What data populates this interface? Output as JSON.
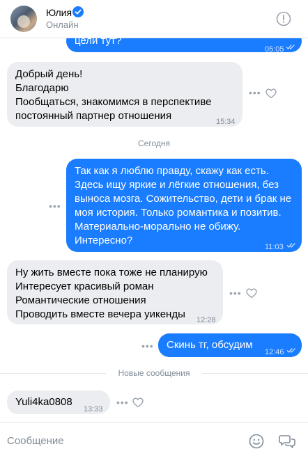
{
  "header": {
    "name": "Юлия",
    "status": "Онлайн"
  },
  "messages": {
    "m0": {
      "text": "цели тут?",
      "time": "05:05"
    },
    "m1": {
      "lines": [
        "Добрый день!",
        "Благодарю",
        "Пообщаться, знакомимся в перспективе",
        "постоянный партнер отношения"
      ],
      "time": "15:34"
    },
    "date_separator": "Сегодня",
    "m2": {
      "lines": [
        "Так как я люблю правду, скажу как есть.",
        "Здесь ищу яркие и лёгкие отношения, без",
        "выноса мозга. Сожительство, дети и брак не",
        "моя история. Только романтика и позитив.",
        "Материально-морально не обижу.",
        "Интересно?"
      ],
      "time": "11:03"
    },
    "m3": {
      "lines": [
        "Ну жить вместе пока тоже не планирую",
        "Интересует красивый роман",
        "Романтические отношения",
        "Проводить вместе вечера уикенды"
      ],
      "time": "12:28"
    },
    "m4": {
      "text": "Скинь тг, обсудим",
      "time": "12:46"
    },
    "new_separator": "Новые сообщения",
    "m5": {
      "text": "Yuli4ka0808",
      "time": "13:33"
    }
  },
  "composer": {
    "placeholder": "Сообщение"
  },
  "icons": {
    "verified": "verified-badge-icon",
    "info": "info-icon",
    "more": "more-dots-icon",
    "like": "heart-icon",
    "read": "double-check-icon",
    "emoji": "emoji-icon",
    "reply": "quick-replies-icon"
  },
  "colors": {
    "accent": "#1a7cff",
    "incoming": "#ebedf0",
    "muted": "#818c99"
  }
}
